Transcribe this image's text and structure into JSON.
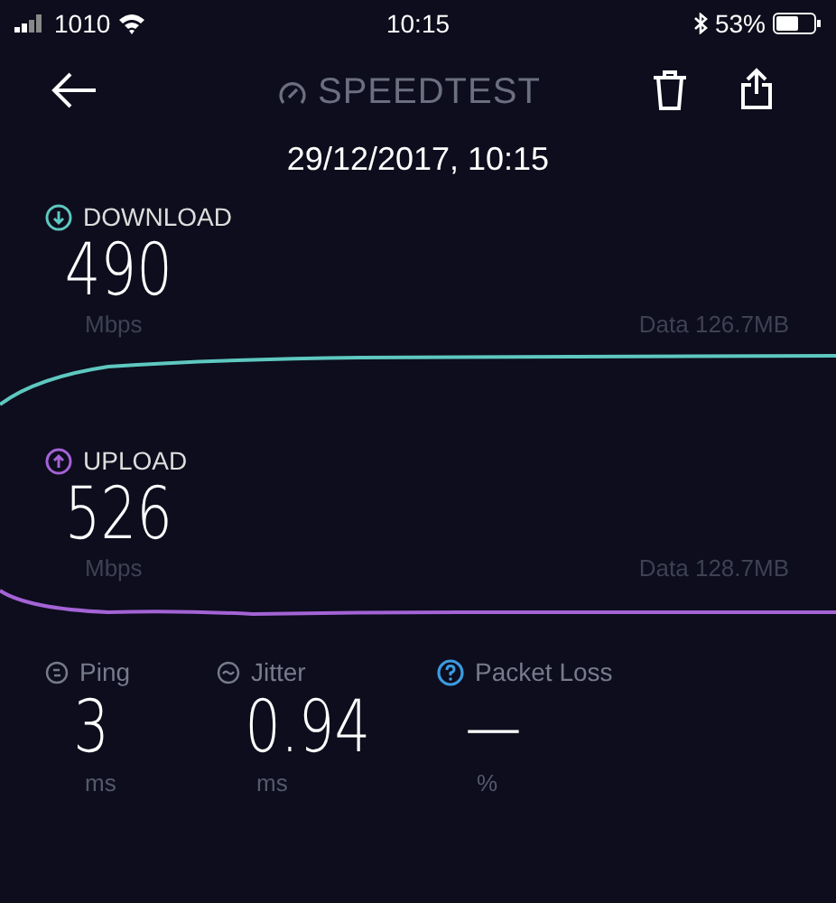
{
  "status_bar": {
    "carrier": "1010",
    "time": "10:15",
    "battery": "53%"
  },
  "header": {
    "title": "SPEEDTEST"
  },
  "date": "29/12/2017, 10:15",
  "tests": [
    {
      "kind": "download",
      "label": "DOWNLOAD",
      "value": "490",
      "unit": "Mbps",
      "data": "Data 126.7MB",
      "color": "#5ec8c0"
    },
    {
      "kind": "upload",
      "label": "UPLOAD",
      "value": "526",
      "unit": "Mbps",
      "data": "Data 128.7MB",
      "color": "#a463d6"
    }
  ],
  "metrics": [
    {
      "kind": "ping",
      "label": "Ping",
      "value": "3",
      "unit": "ms"
    },
    {
      "kind": "jitter",
      "label": "Jitter",
      "value": "0.94",
      "unit": "ms"
    },
    {
      "kind": "packet_loss",
      "label": "Packet Loss",
      "value": "—",
      "unit": "%"
    }
  ]
}
